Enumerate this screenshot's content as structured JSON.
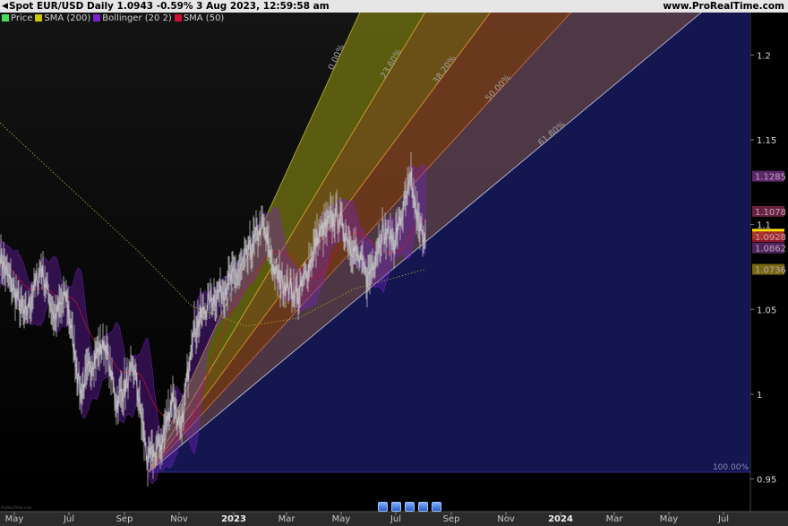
{
  "header": {
    "title": "Spot EUR/USD Daily 1.0943 -0.59% 3 Aug 2023, 12:59:58 am",
    "brand": "www.ProRealTime.com"
  },
  "legend": [
    {
      "label": "Price",
      "color": "#44dd55"
    },
    {
      "label": "SMA (200)",
      "color": "#c8c800"
    },
    {
      "label": "Bollinger (20 2)",
      "color": "#7a22cc"
    },
    {
      "label": "SMA (50)",
      "color": "#cc1133"
    }
  ],
  "watermark": "ProRealTime.com",
  "nav_buttons": [
    "zoom-out",
    "scroll-left",
    "reset",
    "scroll-right",
    "zoom-in"
  ],
  "colors": {
    "price": "#cfcfcf",
    "sma200": "#a89a2a",
    "bollinger": "#7a22cc",
    "sma50": "#cc1133",
    "fan_background": "#141650",
    "last_price_tag": "#ffe000"
  },
  "chart_data": {
    "type": "line",
    "instrument": "Spot EUR/USD Daily",
    "x_tick_labels": [
      "May",
      "Jul",
      "Sep",
      "Nov",
      "2023",
      "Mar",
      "May",
      "Jul",
      "Sep",
      "Nov",
      "2024",
      "Mar",
      "May",
      "Jul"
    ],
    "y_tick_labels": [
      "0.95",
      "1",
      "1.05",
      "1.1",
      "1.15",
      "1.2"
    ],
    "ylim": [
      0.945,
      1.225
    ],
    "grid": false,
    "legend_position": "top-left",
    "x_start": "2022-04-15",
    "x_end": "2024-07-31",
    "price_anchors": [
      [
        "2022-04-15",
        1.081
      ],
      [
        "2022-05-13",
        1.045
      ],
      [
        "2022-05-31",
        1.075
      ],
      [
        "2022-06-15",
        1.045
      ],
      [
        "2022-06-28",
        1.058
      ],
      [
        "2022-07-14",
        1.001
      ],
      [
        "2022-07-29",
        1.022
      ],
      [
        "2022-08-10",
        1.03
      ],
      [
        "2022-08-23",
        0.995
      ],
      [
        "2022-09-12",
        1.015
      ],
      [
        "2022-09-27",
        0.96
      ],
      [
        "2022-10-13",
        0.972
      ],
      [
        "2022-10-25",
        1.0
      ],
      [
        "2022-11-03",
        0.975
      ],
      [
        "2022-11-15",
        1.035
      ],
      [
        "2022-12-05",
        1.055
      ],
      [
        "2022-12-20",
        1.062
      ],
      [
        "2023-01-10",
        1.074
      ],
      [
        "2023-02-02",
        1.1
      ],
      [
        "2023-02-17",
        1.07
      ],
      [
        "2023-03-15",
        1.058
      ],
      [
        "2023-04-05",
        1.093
      ],
      [
        "2023-04-26",
        1.106
      ],
      [
        "2023-05-31",
        1.068
      ],
      [
        "2023-06-15",
        1.095
      ],
      [
        "2023-06-30",
        1.091
      ],
      [
        "2023-07-18",
        1.125
      ],
      [
        "2023-07-27",
        1.097
      ],
      [
        "2023-08-03",
        1.0943
      ]
    ],
    "sma200_anchors": [
      [
        "2022-04-15",
        1.16
      ],
      [
        "2022-06-15",
        1.13
      ],
      [
        "2022-09-15",
        1.085
      ],
      [
        "2022-11-15",
        1.052
      ],
      [
        "2023-01-15",
        1.04
      ],
      [
        "2023-03-15",
        1.045
      ],
      [
        "2023-05-15",
        1.062
      ],
      [
        "2023-08-03",
        1.0736
      ]
    ],
    "fibonacci_fan": {
      "origin": [
        "2022-09-28",
        0.954
      ],
      "levels": [
        {
          "label": "0.00%",
          "value": 0.0
        },
        {
          "label": "23.60%",
          "value": 23.6
        },
        {
          "label": "38.20%",
          "value": 38.2
        },
        {
          "label": "50.00%",
          "value": 50.0
        },
        {
          "label": "61.80%",
          "value": 61.8
        },
        {
          "label": "100.00%",
          "value": 100.0
        }
      ]
    },
    "right_axis_tags": [
      {
        "label": "1.1285",
        "value": 1.1285,
        "color": "#6a2f7a"
      },
      {
        "label": "1.1078",
        "value": 1.1078,
        "color": "#7a2a4a"
      },
      {
        "label": "1.0943",
        "value": 1.0943,
        "color": "#ffe000"
      },
      {
        "label": "1.0928",
        "value": 1.0928,
        "color": "#a01830"
      },
      {
        "label": "1.0862",
        "value": 1.0862,
        "color": "#5a2a6a"
      },
      {
        "label": "1.0736",
        "value": 1.0736,
        "color": "#8a7a10"
      }
    ]
  }
}
